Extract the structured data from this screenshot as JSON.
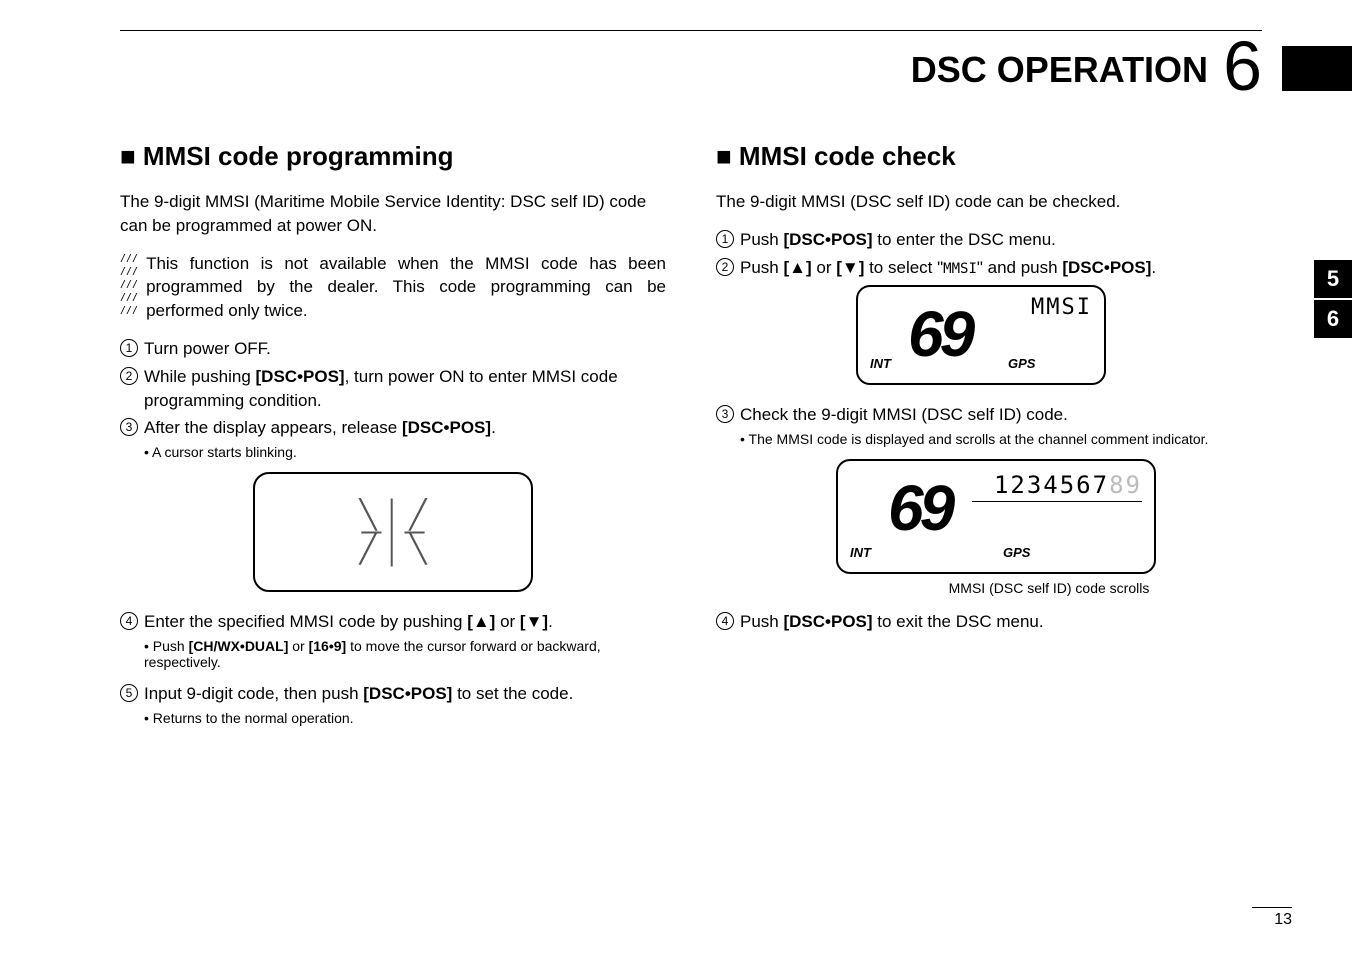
{
  "header": {
    "title": "DSC OPERATION",
    "chapter": "6"
  },
  "sideTabs": [
    "5",
    "6"
  ],
  "pageNumber": "13",
  "left": {
    "sectionTitle": "■ MMSI code programming",
    "intro": "The 9-digit MMSI (Maritime Mobile Service Identity: DSC self ID) code can be programmed at power ON.",
    "note": "This function is not available when the MMSI code has been programmed by the dealer. This code programming can be performed only twice.",
    "steps": [
      {
        "num": "1",
        "text_before": "Turn power OFF."
      },
      {
        "num": "2",
        "text_before": "While pushing ",
        "bold1": "[DSC•POS]",
        "text_after": ", turn power ON to enter MMSI code programming condition."
      },
      {
        "num": "3",
        "text_before": "After the display appears, release ",
        "bold1": "[DSC•POS]",
        "text_after": "."
      }
    ],
    "sub3": "• A cursor starts blinking.",
    "step4_pre": "Enter the specified MMSI code by pushing ",
    "step4_b1": "[▲]",
    "step4_mid": " or ",
    "step4_b2": "[▼]",
    "step4_post": ".",
    "sub4_pre": "• Push ",
    "sub4_b1": "[CH/WX•DUAL]",
    "sub4_mid": " or ",
    "sub4_b2": "[16•9]",
    "sub4_post": " to move the cursor forward or backward, respectively.",
    "step5_pre": "Input 9-digit code, then push ",
    "step5_b1": "[DSC•POS]",
    "step5_post": " to set the code.",
    "sub5": "• Returns to the normal operation."
  },
  "right": {
    "sectionTitle": "■ MMSI code check",
    "intro": "The 9-digit MMSI (DSC self ID) code can be checked.",
    "step1_pre": "Push ",
    "step1_b1": "[DSC•POS]",
    "step1_post": " to enter the DSC menu.",
    "step2_pre": "Push ",
    "step2_b1": "[▲]",
    "step2_mid1": " or ",
    "step2_b2": "[▼]",
    "step2_mid2": " to select \"",
    "step2_glyph": "MMSI",
    "step2_mid3": "\" and push ",
    "step2_b3": "[DSC•POS]",
    "step2_post": ".",
    "lcd1": {
      "int": "INT",
      "channel": "69",
      "gps": "GPS",
      "label": "MMSI"
    },
    "step3": "Check the 9-digit MMSI (DSC self ID) code.",
    "sub3": "• The MMSI code is displayed and scrolls at the channel comment indicator.",
    "lcd2": {
      "int": "INT",
      "channel": "69",
      "gps": "GPS",
      "scroll_dark": "1234567",
      "scroll_light": "89"
    },
    "caption": "MMSI (DSC self ID) code scrolls",
    "step4_pre": "Push ",
    "step4_b1": "[DSC•POS]",
    "step4_post": " to exit the DSC menu."
  }
}
